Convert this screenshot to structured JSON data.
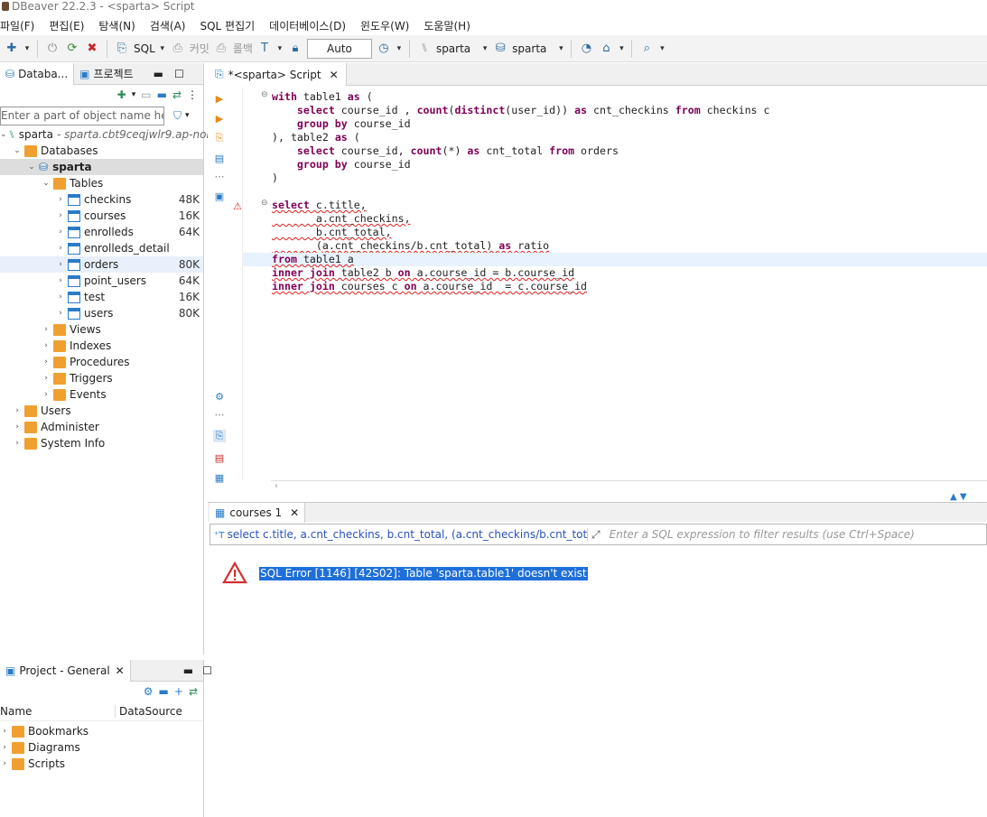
{
  "window": {
    "title": "DBeaver 22.2.3 - <sparta> Script"
  },
  "menu": [
    "파일(F)",
    "편집(E)",
    "탐색(N)",
    "검색(A)",
    "SQL 편집기",
    "데이터베이스(D)",
    "윈도우(W)",
    "도움말(H)"
  ],
  "toolbar": {
    "sql_label": "SQL",
    "commit_label": "커밋",
    "rollback_label": "롤백",
    "tx_mode": "Auto",
    "datasource": "sparta",
    "schema": "sparta"
  },
  "navigator": {
    "tab_database": "Databa...",
    "tab_project": "프로젝트",
    "filter_placeholder": "Enter a part of object name here",
    "connection": {
      "name": "sparta",
      "host": " - sparta.cbt9ceqjwlr9.ap-nor"
    },
    "databases_label": "Databases",
    "schema_label": "sparta",
    "tables_label": "Tables",
    "tables": [
      {
        "name": "checkins",
        "size": "48K"
      },
      {
        "name": "courses",
        "size": "16K"
      },
      {
        "name": "enrolleds",
        "size": "64K"
      },
      {
        "name": "enrolleds_detail",
        "size": ""
      },
      {
        "name": "orders",
        "size": "80K"
      },
      {
        "name": "point_users",
        "size": "64K"
      },
      {
        "name": "test",
        "size": "16K"
      },
      {
        "name": "users",
        "size": "80K"
      }
    ],
    "folders": [
      "Views",
      "Indexes",
      "Procedures",
      "Triggers",
      "Events"
    ],
    "root_items": [
      "Users",
      "Administer",
      "System Info"
    ]
  },
  "editor": {
    "tab_label": "*<sparta> Script",
    "lines": [
      "with table1 as (",
      "    select course_id , count(distinct(user_id)) as cnt_checkins from checkins c",
      "    group by course_id",
      "), table2 as (",
      "    select course_id, count(*) as cnt_total from orders",
      "    group by course_id",
      ")",
      "",
      "select c.title,",
      "       a.cnt_checkins,",
      "       b.cnt_total,",
      "       (a.cnt_checkins/b.cnt_total) as ratio",
      "from table1 a",
      "inner join table2 b on a.course_id = b.course_id",
      "inner join courses c on a.course_id  = c.course_id"
    ]
  },
  "results": {
    "tab_label": "courses 1",
    "query_text": "select c.title, a.cnt_checkins, b.cnt_total, (a.cnt_checkins/b.cnt_total) as ratio",
    "filter_placeholder": "Enter a SQL expression to filter results (use Ctrl+Space)",
    "error": "SQL Error [1146] [42S02]: Table 'sparta.table1' doesn't exist"
  },
  "project_panel": {
    "tab_label": "Project - General",
    "col_name": "Name",
    "col_datasource": "DataSource",
    "items": [
      "Bookmarks",
      "Diagrams",
      "Scripts"
    ]
  }
}
